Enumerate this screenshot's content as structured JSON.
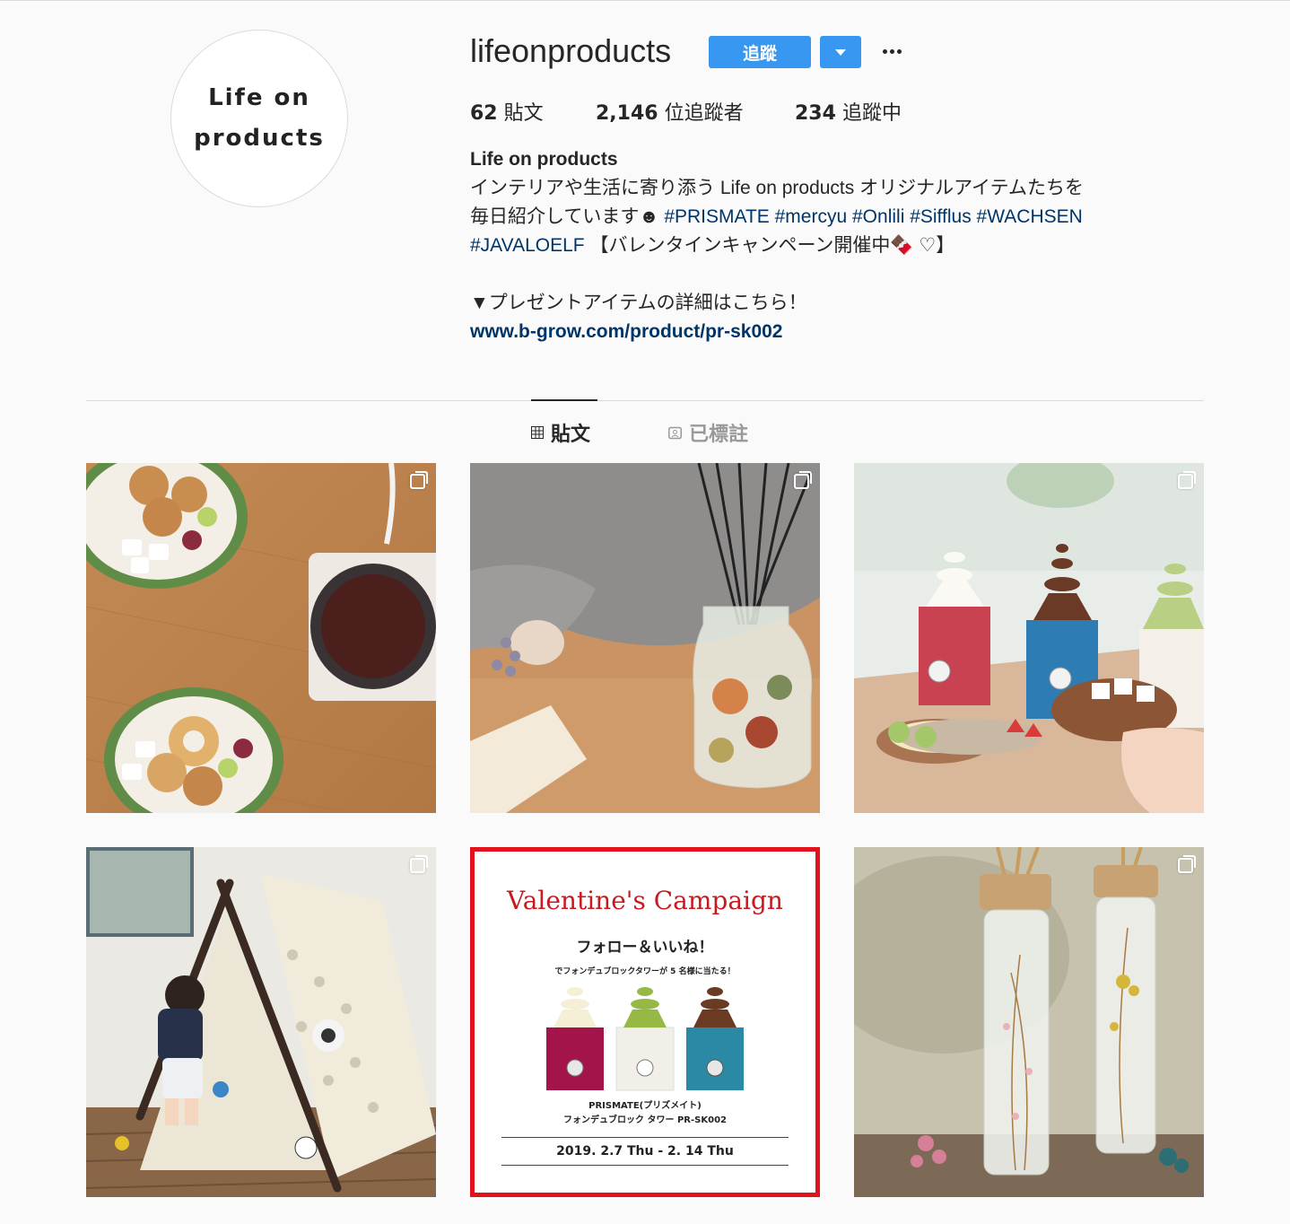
{
  "profile": {
    "avatar_line1": "Life on",
    "avatar_line2": "products",
    "username": "lifeonproducts",
    "follow_label": "追蹤"
  },
  "stats": {
    "posts_count": "62",
    "posts_label": "貼文",
    "followers_count": "2,146",
    "followers_label": "位追蹤者",
    "following_count": "234",
    "following_label": "追蹤中"
  },
  "bio": {
    "name": "Life on products",
    "line1": "インテリアや生活に寄り添う Life on products オリジナルアイテムたちを",
    "line2_text": "毎日紹介しています☻",
    "tags_line2": [
      "#PRISMATE",
      "#mercyu",
      "#Onlili",
      "#Sifflus",
      "#WACHSEN"
    ],
    "tag_line3": "#JAVALOELF",
    "campaign_text": "【バレンタインキャンペーン開催中🍫 ♡】",
    "present_text": "▼プレゼントアイテムの詳細はこちら！",
    "link": "www.b-grow.com/product/pr-sk002"
  },
  "tabs": {
    "posts": "貼文",
    "tagged": "已標註"
  },
  "valentine_post": {
    "title": "Valentine's Campaign",
    "subtitle": "フォロー＆いいね！",
    "subtitle2": "でフォンデュブロックタワーが 5 名様に当たる！",
    "product_line1": "PRISMATE(プリズメイト)",
    "product_line2": "フォンデュブロック タワー PR-SK002",
    "date": "2019. 2.7 Thu  -  2. 14 Thu"
  },
  "colors": {
    "accent": "#3897f0",
    "link": "#003569",
    "valentine_red": "#e3101d"
  }
}
